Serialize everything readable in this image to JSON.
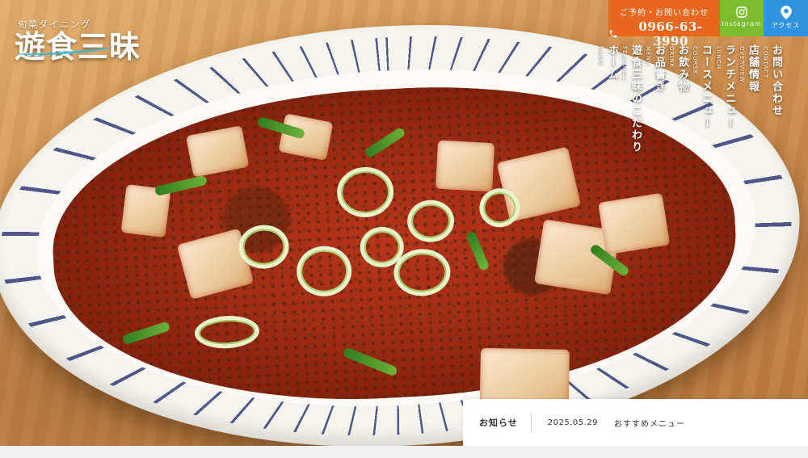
{
  "brand": {
    "tagline": "旬菜ダイニング",
    "name": "遊食三昧"
  },
  "header": {
    "reserve": {
      "title": "ご予約・お問い合わせ",
      "phone": "0966-63-3990"
    },
    "instagram_label": "Instagram",
    "access_label": "アクセス"
  },
  "colors": {
    "reserve": "#e8661e",
    "instagram": "#7bbd2f",
    "access": "#2f93e0"
  },
  "nav": {
    "items": [
      {
        "jp": "お問い合わせ",
        "en": "CONTACT"
      },
      {
        "jp": "店舗情報",
        "en": "OVERVIEW"
      },
      {
        "jp": "ランチメニュー",
        "en": "LUNCH"
      },
      {
        "jp": "コースメニュー",
        "en": "COURSE"
      },
      {
        "jp": "お飲み物",
        "en": "DRINK"
      },
      {
        "jp": "お品書き",
        "en": "MENU"
      },
      {
        "jp": "遊食三昧のこだわり",
        "en": "FEATURES"
      },
      {
        "jp": "ホーム",
        "en": "HOME"
      }
    ]
  },
  "news": {
    "label": "お知らせ",
    "date": "2025.05.29",
    "title": "おすすめメニュー"
  },
  "icons": {
    "phone": "phone-icon",
    "instagram": "instagram-icon",
    "access": "map-pin-icon"
  }
}
